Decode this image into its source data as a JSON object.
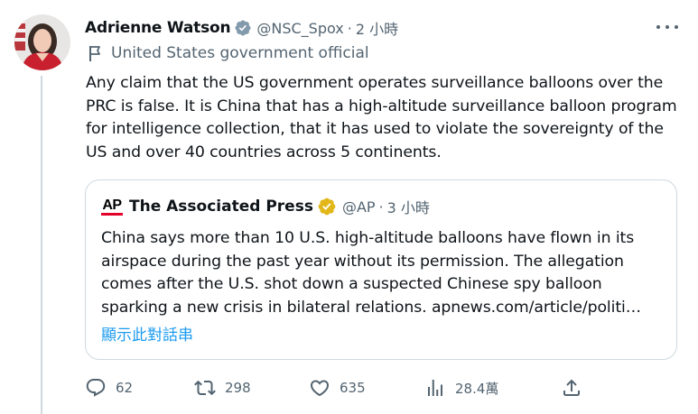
{
  "tweet": {
    "display_name": "Adrienne Watson",
    "handle": "@NSC_Spox",
    "separator": "·",
    "time": "2 小時",
    "affiliation": "United States government official",
    "text": "Any claim that the US government operates surveillance balloons over the PRC is false. It is China that has a high-altitude surveillance balloon program for intelligence collection, that it has used to violate the sovereignty of the US and over 40 countries across 5 continents."
  },
  "quote": {
    "logo_text": "AP",
    "display_name": "The Associated Press",
    "handle": "@AP",
    "separator": "·",
    "time": "3 小時",
    "text": "China says more than 10 U.S. high-altitude balloons have flown in its airspace during the past year without its permission. The allegation comes after the U.S. shot down a suspected Chinese spy balloon sparking a new crisis in bilateral relations. apnews.com/article/politi…",
    "show_thread": "顯示此對話串",
    "verified_badge": "gold"
  },
  "actions": {
    "replies": "62",
    "retweets": "298",
    "likes": "635",
    "views": "28.4萬"
  },
  "colors": {
    "text": "#0f1419",
    "secondary": "#536471",
    "link": "#1d9bf0",
    "verified_gray": "#829aab",
    "verified_gold": "#e2b719",
    "border": "#cfd9de",
    "ap_red": "#e4002b"
  },
  "icons": {
    "more": "more-icon",
    "verified": "verified-badge-icon",
    "government": "government-flag-icon",
    "reply": "reply-icon",
    "retweet": "retweet-icon",
    "like": "heart-icon",
    "views": "views-icon",
    "share": "share-icon"
  }
}
